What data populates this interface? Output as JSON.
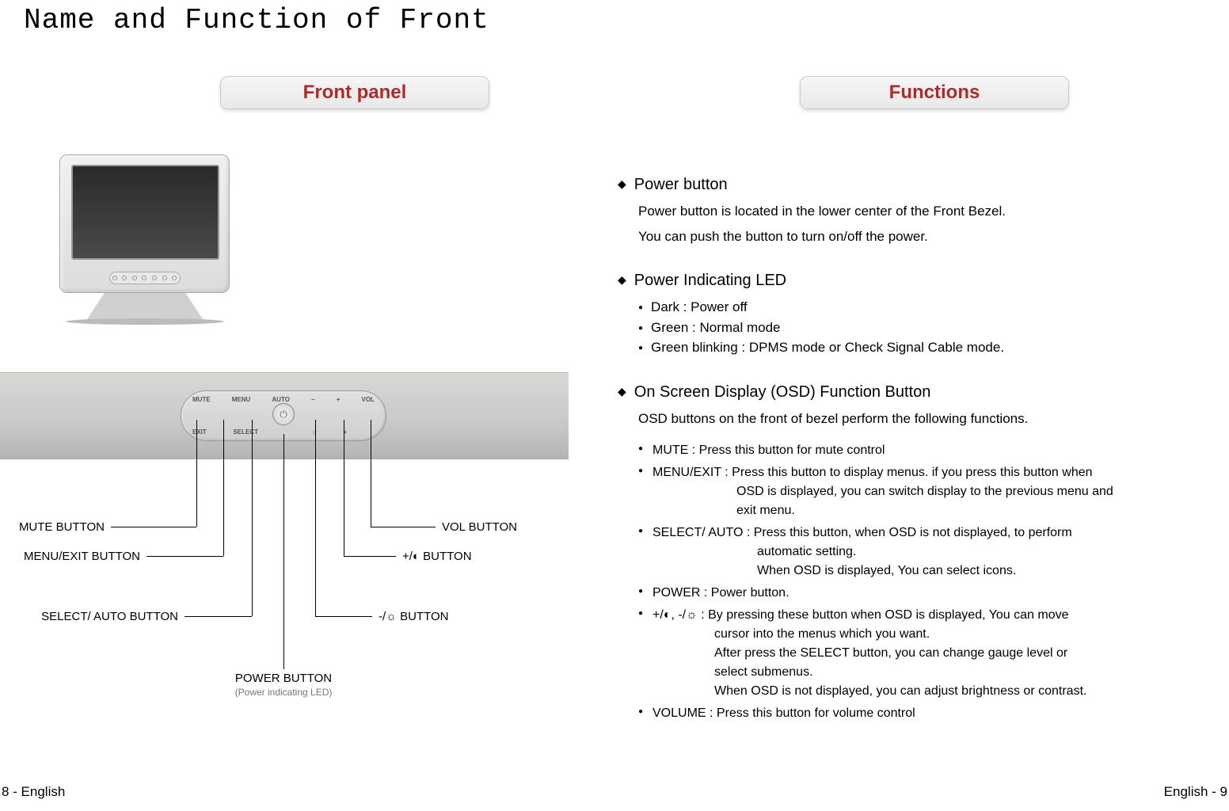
{
  "title": "Name and Function of  Front",
  "tabs": {
    "left": "Front panel",
    "right": "Functions"
  },
  "panel": {
    "top_row": [
      "MUTE",
      "MENU",
      "AUTO",
      "−",
      "+",
      "VOL"
    ],
    "bottom_row": [
      "EXIT",
      "SELECT",
      "",
      "☼",
      "◐",
      ""
    ]
  },
  "callouts": {
    "mute": "MUTE BUTTON",
    "menu": "MENU/EXIT BUTTON",
    "select": "SELECT/ AUTO BUTTON",
    "power": "POWER  BUTTON",
    "power_sub": "(Power indicating LED)",
    "vol": "VOL BUTTON",
    "plus": "+/◐ BUTTON",
    "minus": "-/☼ BUTTON"
  },
  "functions": {
    "power": {
      "title": "Power button",
      "line1": "Power button is located in the lower center of the Front Bezel.",
      "line2": "You can push the button to turn on/off the power."
    },
    "led": {
      "title": "Power Indicating LED",
      "items": [
        "Dark : Power off",
        "Green : Normal mode",
        "Green blinking : DPMS mode or Check Signal Cable mode."
      ]
    },
    "osd": {
      "title": "On Screen Display (OSD) Function Button",
      "intro": "OSD buttons on the front of bezel perform the following functions.",
      "items": {
        "mute": "MUTE : Press this button for mute control",
        "menu_a": "MENU/EXIT : Press this button to display menus. if you press this button when",
        "menu_b": "OSD is displayed, you can switch display to the previous menu and",
        "menu_c": "exit menu.",
        "select_a": "SELECT/ AUTO : Press this button, when OSD is not displayed, to perform",
        "select_b": "automatic setting.",
        "select_c": "When OSD is displayed, You can select icons.",
        "power": "POWER : Power button.",
        "pm_sym": " +/◐,  -/☼ ",
        "pm_a": " : By pressing these button when OSD is displayed, You can move",
        "pm_b": "cursor into  the menus which you want.",
        "pm_c": "After press the SELECT button, you can change  gauge level or",
        "pm_d": "select submenus.",
        "pm_e": "When OSD is not displayed, you can adjust brightness or contrast.",
        "volume": "VOLUME : Press this button for volume control"
      }
    }
  },
  "footer": {
    "left": "8 - English",
    "right": "English - 9"
  }
}
